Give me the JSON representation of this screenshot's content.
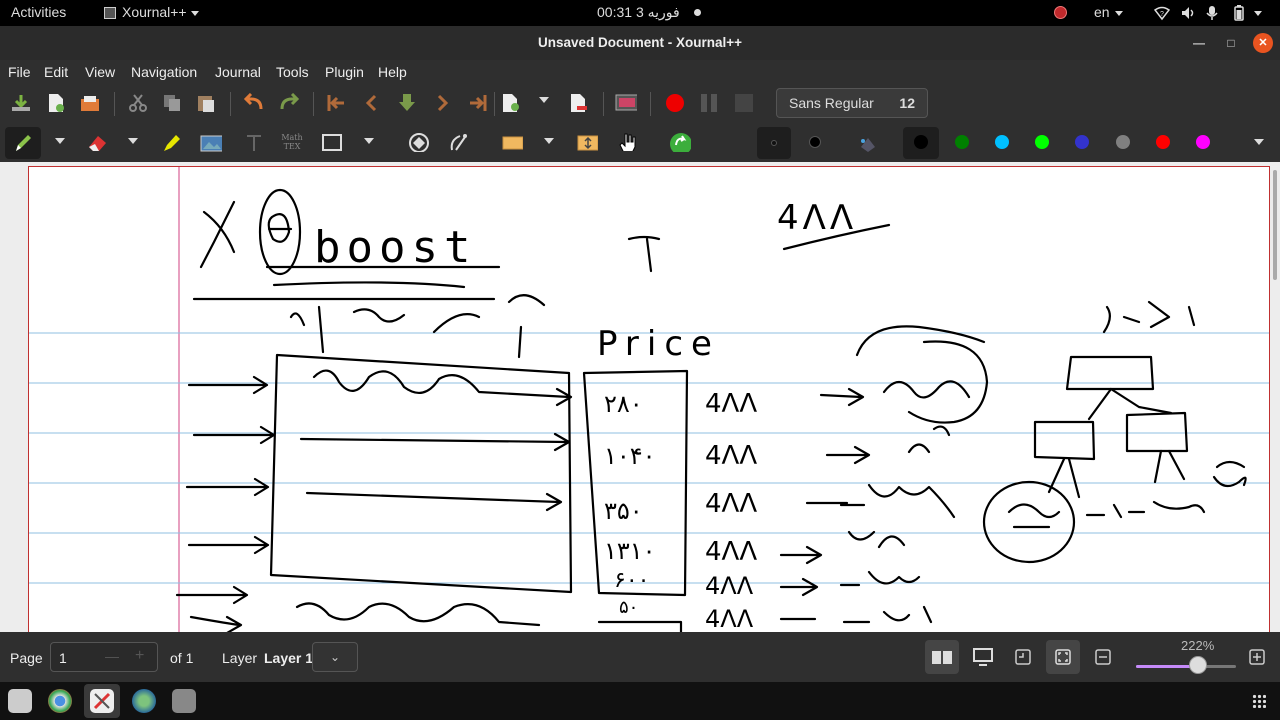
{
  "topbar": {
    "activities": "Activities",
    "app_menu": "Xournal++",
    "clock": "00:31  فوریه 3",
    "language": "en"
  },
  "window": {
    "title": "Unsaved Document - Xournal++"
  },
  "menu": [
    "File",
    "Edit",
    "View",
    "Navigation",
    "Journal",
    "Tools",
    "Plugin",
    "Help"
  ],
  "toolbar": {
    "font_name": "Sans Regular",
    "font_size": "12",
    "tex_label_top": "Math",
    "tex_label_bottom": "TEX"
  },
  "palette": [
    "#000000",
    "#008000",
    "#00c0ff",
    "#00ff00",
    "#3333cc",
    "#808080",
    "#ff0000",
    "#ff00ff"
  ],
  "status": {
    "page_label": "Page",
    "page_value": "1",
    "page_of": "of 1",
    "layer_label": "Layer",
    "layer_value": "Layer 1",
    "zoom": "222%",
    "zoom_level": 0.62
  },
  "canvas": {
    "title_text": "boost",
    "price_text": "Price",
    "note_top": "4ΛΛ",
    "price_values": [
      "۲۸۰",
      "۱۰۴۰",
      "۳۵۰",
      "۱۳۱۰",
      "۶۰۰",
      "۵۰"
    ],
    "row_values": [
      "4ΛΛ",
      "4ΛΛ",
      "4ΛΛ",
      "4ΛΛ",
      "4ΛΛ",
      "4ΛΛ"
    ]
  }
}
